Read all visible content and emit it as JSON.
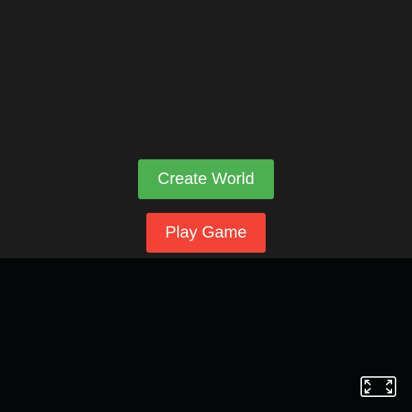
{
  "menu": {
    "create_world_label": "Create World",
    "play_game_label": "Play Game"
  },
  "controls": {
    "fullscreen_icon": "fullscreen-expand-icon"
  },
  "colors": {
    "create_world_button": "#4caf50",
    "play_game_button": "#f44336",
    "upper_background": "#1c1c1c",
    "lower_background": "#040707",
    "icon_stroke": "#ffffff"
  }
}
